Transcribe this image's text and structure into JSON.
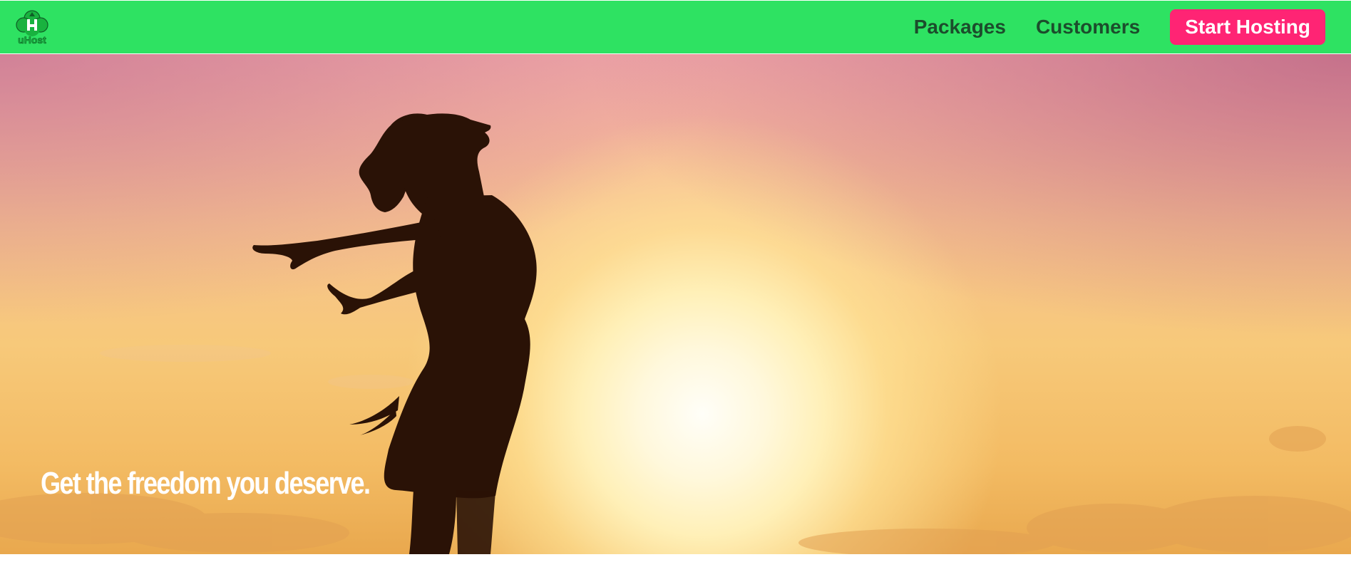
{
  "header": {
    "logo_text": "uHost",
    "logo_icon": "cloud-upload-icon",
    "nav": [
      {
        "label": "Packages"
      },
      {
        "label": "Customers"
      }
    ],
    "cta_label": "Start Hosting"
  },
  "hero": {
    "title": "Get the freedom you deserve."
  },
  "colors": {
    "header_bg": "#2ee262",
    "nav_text": "#1c4d2c",
    "cta_bg": "#ff2474",
    "cta_text": "#ffffff",
    "hero_text": "#ffffff"
  }
}
